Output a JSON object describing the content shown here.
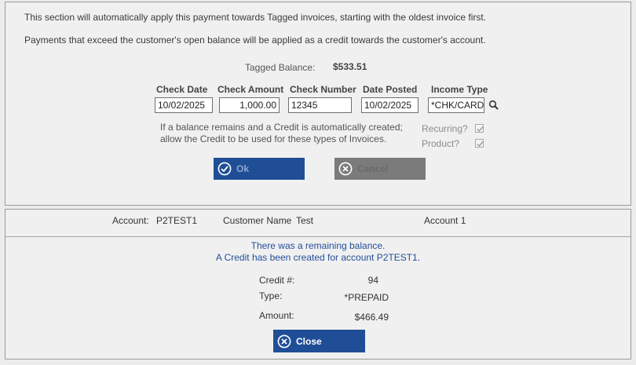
{
  "intro": {
    "line1": "This section will automatically apply this payment towards Tagged invoices, starting with the oldest invoice first.",
    "line2": "Payments that exceed the customer's open balance will be applied as a credit towards the customer's account."
  },
  "tagged_balance": {
    "label": "Tagged Balance:",
    "value": "$533.51"
  },
  "form": {
    "check_date": {
      "label": "Check Date",
      "value": "10/02/2025"
    },
    "check_amount": {
      "label": "Check Amount",
      "value": "1,000.00"
    },
    "check_number": {
      "label": "Check Number",
      "value": "12345"
    },
    "date_posted": {
      "label": "Date Posted",
      "value": "10/02/2025"
    },
    "income_type": {
      "label": "Income Type",
      "value": "*CHK/CARD"
    },
    "search_icon": "magnifier-icon"
  },
  "credit_note": {
    "line1": "If a balance remains and a Credit is automatically created;",
    "line2": "allow the Credit to be used for these types of Invoices.",
    "recurring_label": "Recurring?",
    "recurring_checked": true,
    "product_label": "Product?",
    "product_checked": true
  },
  "buttons": {
    "ok": {
      "label": "Ok",
      "icon": "check-circle-icon"
    },
    "cancel": {
      "label": "Cancel",
      "icon": "x-circle-icon"
    },
    "close": {
      "label": "Close",
      "icon": "x-circle-icon"
    }
  },
  "account_bar": {
    "account_label": "Account:",
    "account_value": "P2TEST1",
    "customer_label": "Customer Name",
    "customer_value": "Test",
    "account_name": "Account 1"
  },
  "result": {
    "message1": "There was a remaining balance.",
    "message2": "A Credit has been created for account P2TEST1.",
    "credit_no_label": "Credit #:",
    "credit_no_value": "94",
    "type_label": "Type:",
    "type_value": "*PREPAID",
    "amount_label": "Amount:",
    "amount_value": "$466.49"
  },
  "colors": {
    "primary_button": "#1f4e96",
    "disabled_button": "#7b7b7b",
    "message_text": "#24509a"
  }
}
